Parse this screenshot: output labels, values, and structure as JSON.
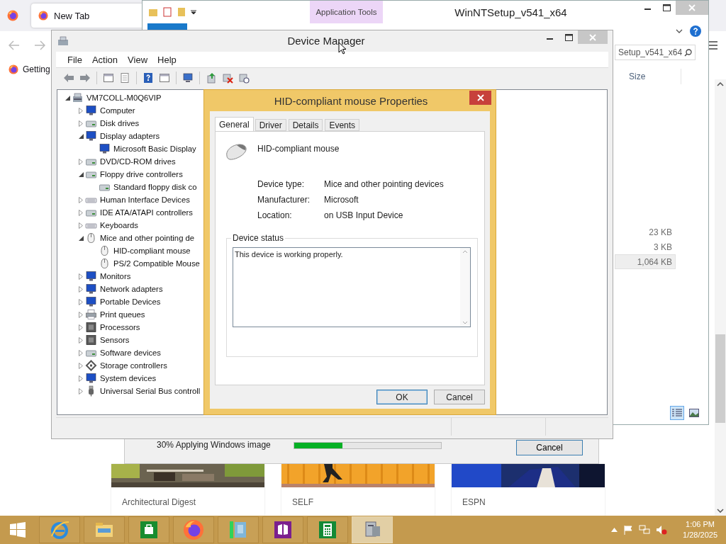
{
  "browser": {
    "tabs": [
      {
        "label": "New Tab",
        "selected": true
      }
    ],
    "bookmarks": [
      {
        "label": "Getting"
      }
    ],
    "cards": [
      {
        "title": "Architectural Digest"
      },
      {
        "title": "SELF"
      },
      {
        "title": "ESPN"
      }
    ]
  },
  "explorer": {
    "title": "WinNTSetup_v541_x64",
    "context_tab": "Application Tools",
    "search": {
      "value": "Setup_v541_x64"
    },
    "columns": [
      {
        "label": "Size"
      }
    ],
    "rows": [
      {
        "size": "23 KB",
        "selected": false
      },
      {
        "size": "3 KB",
        "selected": false
      },
      {
        "size": "1,064 KB",
        "selected": true
      }
    ],
    "views": [
      {
        "kind": "details",
        "selected": true
      },
      {
        "kind": "tiles",
        "selected": false
      }
    ]
  },
  "progress": {
    "text": "30% Applying Windows image",
    "level": 0.33,
    "button": "Cancel"
  },
  "device_manager": {
    "title": "Device Manager",
    "menu": [
      "File",
      "Action",
      "View",
      "Help"
    ],
    "tree": {
      "label": "VM7COLL-M0Q6VIP",
      "kind": "computer",
      "expanded": true,
      "children": [
        {
          "label": "Computer",
          "kind": "monitor",
          "expanded": false
        },
        {
          "label": "Disk drives",
          "kind": "drive",
          "expanded": false
        },
        {
          "label": "Display adapters",
          "kind": "monitor",
          "expanded": true,
          "children": [
            {
              "label": "Microsoft Basic Display",
              "kind": "monitor"
            }
          ]
        },
        {
          "label": "DVD/CD-ROM drives",
          "kind": "drive",
          "expanded": false
        },
        {
          "label": "Floppy drive controllers",
          "kind": "drive",
          "expanded": true,
          "children": [
            {
              "label": "Standard floppy disk co",
              "kind": "drive"
            }
          ]
        },
        {
          "label": "Human Interface Devices",
          "kind": "keyboard",
          "expanded": false
        },
        {
          "label": "IDE ATA/ATAPI controllers",
          "kind": "drive",
          "expanded": false
        },
        {
          "label": "Keyboards",
          "kind": "keyboard",
          "expanded": false
        },
        {
          "label": "Mice and other pointing de",
          "kind": "mouse",
          "expanded": true,
          "children": [
            {
              "label": "HID-compliant mouse",
              "kind": "mouse"
            },
            {
              "label": "PS/2 Compatible Mouse",
              "kind": "mouse"
            }
          ]
        },
        {
          "label": "Monitors",
          "kind": "monitor",
          "expanded": false
        },
        {
          "label": "Network adapters",
          "kind": "monitor",
          "expanded": false
        },
        {
          "label": "Portable Devices",
          "kind": "monitor",
          "expanded": false
        },
        {
          "label": "Print queues",
          "kind": "printer",
          "expanded": false
        },
        {
          "label": "Processors",
          "kind": "chip",
          "expanded": false
        },
        {
          "label": "Sensors",
          "kind": "chip",
          "expanded": false
        },
        {
          "label": "Software devices",
          "kind": "drive",
          "expanded": false
        },
        {
          "label": "Storage controllers",
          "kind": "connector",
          "expanded": false
        },
        {
          "label": "System devices",
          "kind": "monitor",
          "expanded": false
        },
        {
          "label": "Universal Serial Bus controll",
          "kind": "plug",
          "expanded": false
        }
      ]
    }
  },
  "dialog": {
    "title": "HID-compliant mouse Properties",
    "tabs": [
      {
        "label": "General",
        "selected": true
      },
      {
        "label": "Driver",
        "selected": false
      },
      {
        "label": "Details",
        "selected": false
      },
      {
        "label": "Events",
        "selected": false
      }
    ],
    "device_name": "HID-compliant mouse",
    "properties": [
      {
        "label": "Device type:",
        "value": "Mice and other pointing devices"
      },
      {
        "label": "Manufacturer:",
        "value": "Microsoft"
      },
      {
        "label": "Location:",
        "value": "on USB Input Device"
      }
    ],
    "status_label": "Device status",
    "status_text": "This device is working properly.",
    "buttons": [
      {
        "label": "OK",
        "default": true
      },
      {
        "label": "Cancel",
        "default": false
      }
    ]
  },
  "taskbar": {
    "apps": [
      {
        "kind": "ie",
        "selected": false
      },
      {
        "kind": "folder",
        "selected": false
      },
      {
        "kind": "store",
        "selected": false
      },
      {
        "kind": "firefox",
        "selected": false
      },
      {
        "kind": "book",
        "selected": false
      },
      {
        "kind": "tiles",
        "selected": false
      },
      {
        "kind": "calculator",
        "selected": false
      },
      {
        "kind": "device",
        "selected": true
      }
    ],
    "clock": {
      "time": "1:06 PM",
      "date": "1/28/2025"
    }
  }
}
